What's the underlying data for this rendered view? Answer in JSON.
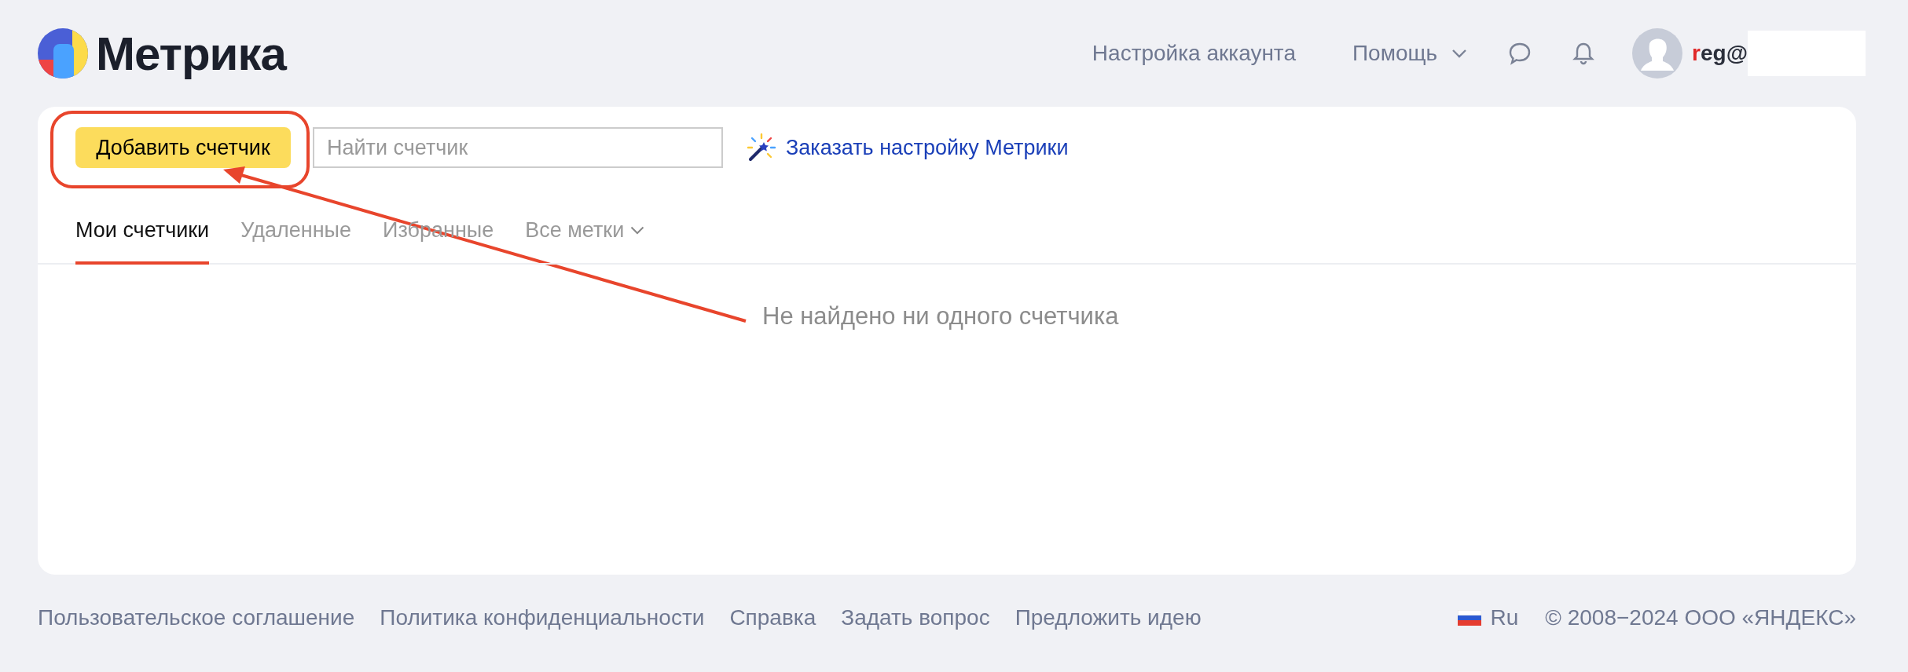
{
  "logo": {
    "text": "Метрика"
  },
  "header": {
    "account_settings": "Настройка аккаунта",
    "help": "Помощь",
    "user": {
      "name_first": "r",
      "name_rest": "eg@"
    }
  },
  "toolbar": {
    "add_button": "Добавить счетчик",
    "search": {
      "placeholder": "Найти счетчик"
    },
    "order_link": "Заказать настройку Метрики"
  },
  "tabs": [
    {
      "label": "Мои счетчики",
      "selected": true,
      "kind": "tab"
    },
    {
      "label": "Удаленные",
      "selected": false,
      "kind": "tab"
    },
    {
      "label": "Избранные",
      "selected": false,
      "kind": "tab"
    },
    {
      "label": "Все метки",
      "selected": false,
      "kind": "dropdown"
    }
  ],
  "empty_message": "Не найдено ни одного счетчика",
  "footer": {
    "links": [
      "Пользовательское соглашение",
      "Политика конфиденциальности",
      "Справка",
      "Задать вопрос",
      "Предложить идею"
    ],
    "language": "Ru",
    "copyright": "© 2008−2024 ООО «ЯНДЕКС»"
  }
}
